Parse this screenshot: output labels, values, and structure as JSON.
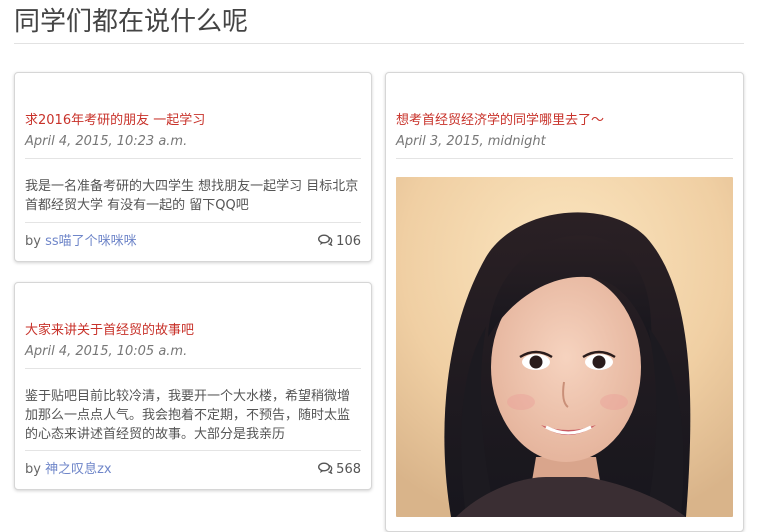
{
  "page": {
    "title": "同学们都在说什么呢"
  },
  "posts": [
    {
      "title": "求2016年考研的朋友 一起学习",
      "date": "April 4, 2015, 10:23 a.m.",
      "body": "我是一名准备考研的大四学生 想找朋友一起学习 目标北京首都经贸大学 有没有一起的 留下QQ吧",
      "by_label": "by",
      "author": "ss喵了个咪咪咪",
      "comments": "106"
    },
    {
      "title": "大家来讲关于首经贸的故事吧",
      "date": "April 4, 2015, 10:05 a.m.",
      "body": "鉴于贴吧目前比较冷清，我要开一个大水楼，希望稍微增加那么一点点人气。我会抱着不定期，不预告，随时太监的心态来讲述首经贸的故事。大部分是我亲历",
      "by_label": "by",
      "author": "神之叹息zx",
      "comments": "568"
    },
    {
      "title": "想考首经贸经济学的同学哪里去了～",
      "date": "April 3, 2015, midnight"
    }
  ],
  "colors": {
    "title_red": "#c8322a",
    "link_blue": "#6f86c9"
  },
  "icons": {
    "comments": "comment-bubbles-icon"
  }
}
